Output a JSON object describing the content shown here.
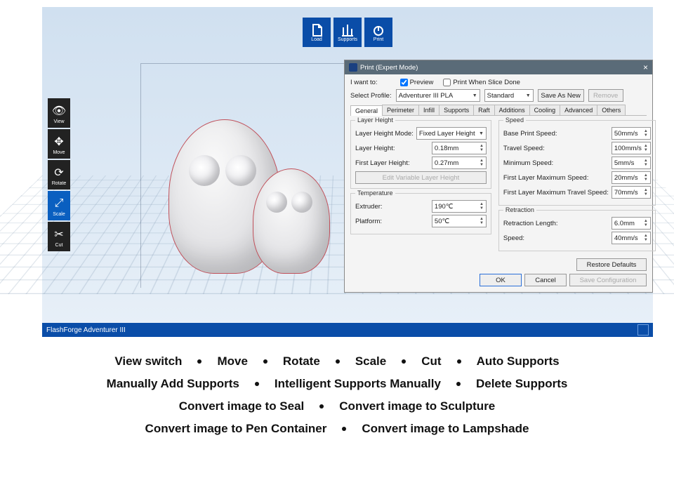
{
  "top_toolbar": {
    "load": "Load",
    "supports": "Supports",
    "print": "Print"
  },
  "side_toolbar": {
    "view": "View",
    "move": "Move",
    "rotate": "Rotate",
    "scale": "Scale",
    "cut": "Cut"
  },
  "statusbar": {
    "printer": "FlashForge Adventurer III"
  },
  "dialog": {
    "title": "Print (Expert Mode)",
    "i_want_to": "I want to:",
    "preview": "Preview",
    "print_when_slice_done": "Print When Slice Done",
    "select_profile": "Select Profile:",
    "profile_value": "Adventurer III PLA",
    "quality_value": "Standard",
    "save_as_new": "Save As New",
    "remove": "Remove",
    "tabs": [
      "General",
      "Perimeter",
      "Infill",
      "Supports",
      "Raft",
      "Additions",
      "Cooling",
      "Advanced",
      "Others"
    ],
    "layer_height": {
      "legend": "Layer Height",
      "mode_label": "Layer Height Mode:",
      "mode_value": "Fixed Layer Height",
      "height_label": "Layer Height:",
      "height_value": "0.18mm",
      "first_label": "First Layer Height:",
      "first_value": "0.27mm",
      "edit_btn": "Edit Variable Layer Height"
    },
    "temperature": {
      "legend": "Temperature",
      "extruder_label": "Extruder:",
      "extruder_value": "190℃",
      "platform_label": "Platform:",
      "platform_value": "50℃"
    },
    "speed": {
      "legend": "Speed",
      "base_label": "Base Print Speed:",
      "base_value": "50mm/s",
      "travel_label": "Travel Speed:",
      "travel_value": "100mm/s",
      "min_label": "Minimum Speed:",
      "min_value": "5mm/s",
      "fl_max_label": "First Layer Maximum Speed:",
      "fl_max_value": "20mm/s",
      "fl_trav_label": "First Layer Maximum Travel Speed:",
      "fl_trav_value": "70mm/s"
    },
    "retraction": {
      "legend": "Retraction",
      "length_label": "Retraction Length:",
      "length_value": "6.0mm",
      "speed_label": "Speed:",
      "speed_value": "40mm/s"
    },
    "restore": "Restore Defaults",
    "ok": "OK",
    "cancel": "Cancel",
    "save_config": "Save Configuration"
  },
  "features": {
    "row1": [
      "View switch",
      "Move",
      "Rotate",
      "Scale",
      "Cut",
      "Auto Supports"
    ],
    "row2": [
      "Manually Add Supports",
      "Intelligent Supports Manually",
      "Delete Supports"
    ],
    "row3": [
      "Convert image to Seal",
      "Convert image to Sculpture"
    ],
    "row4": [
      "Convert image to Pen Container",
      "Convert image to Lampshade"
    ]
  }
}
